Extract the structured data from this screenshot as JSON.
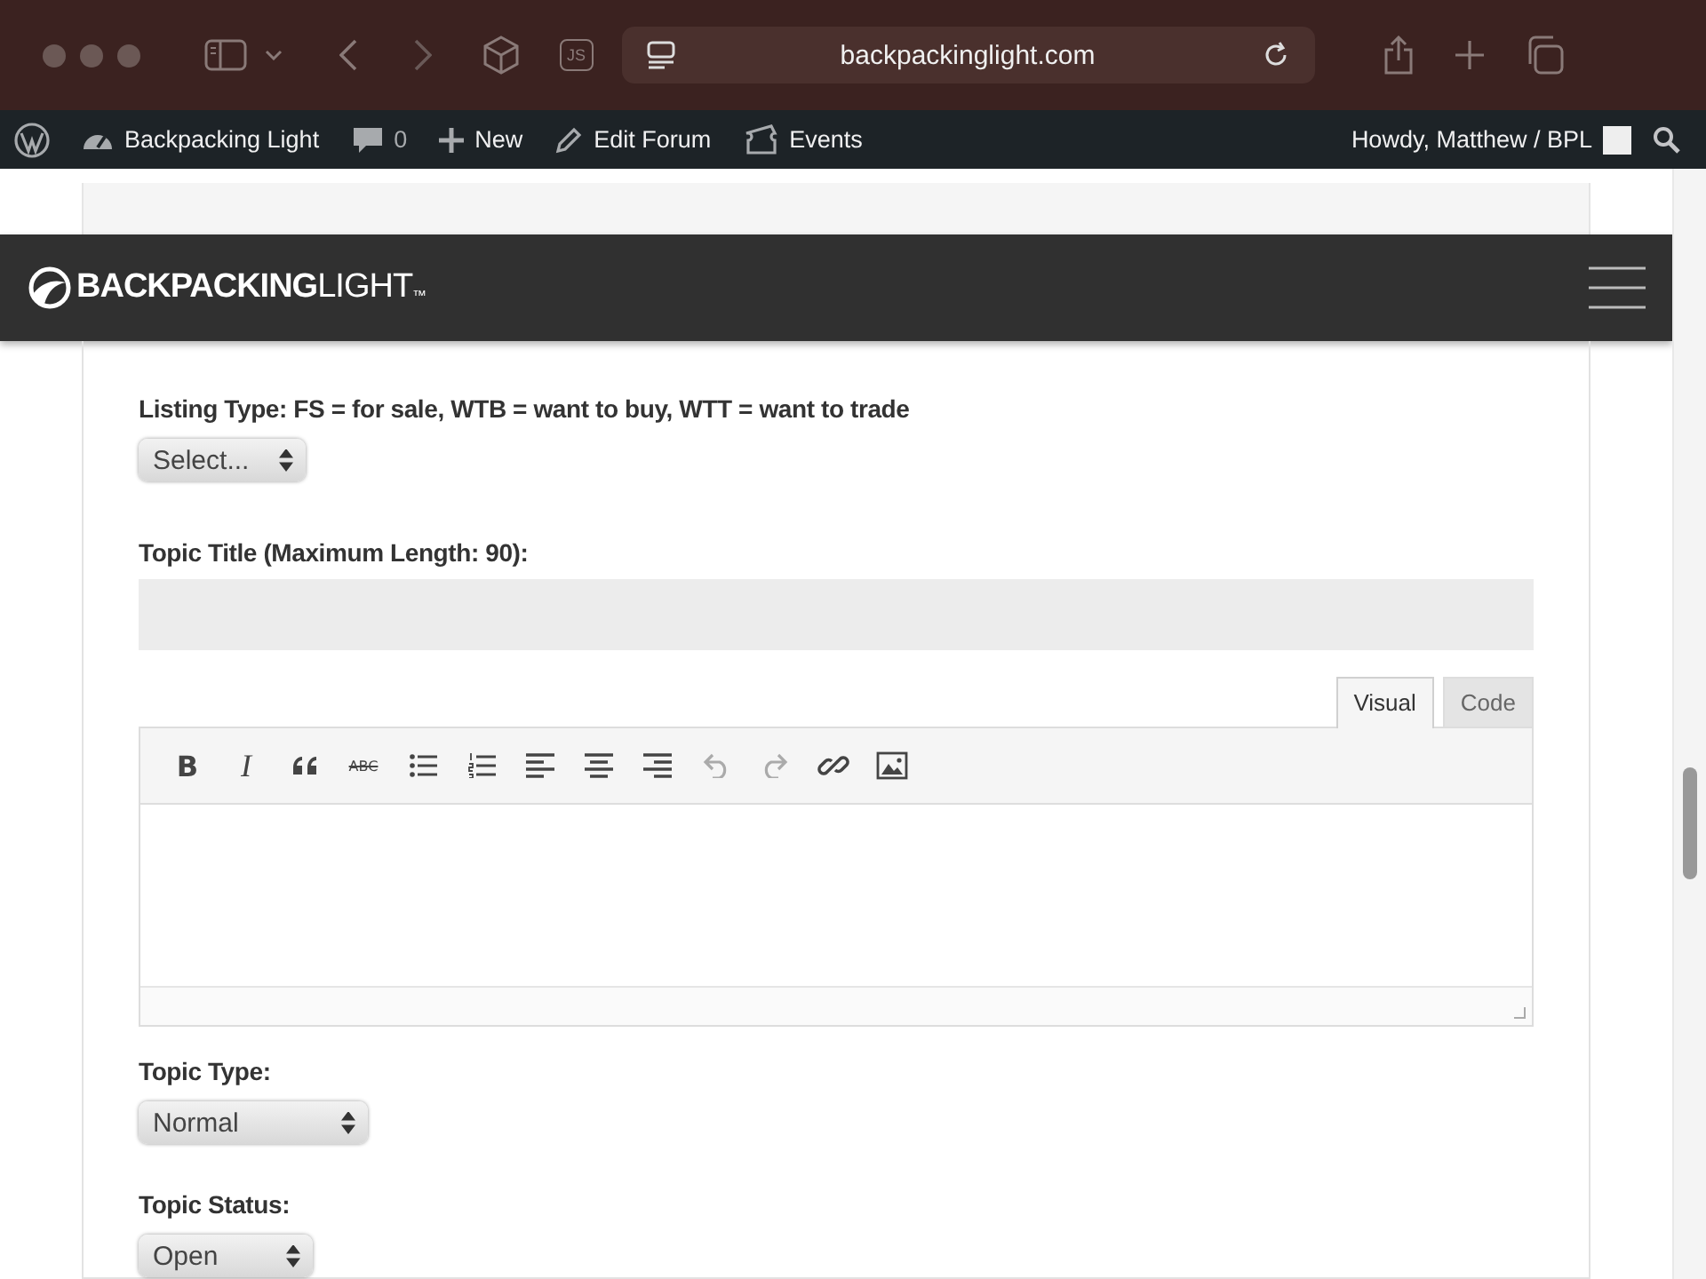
{
  "browser": {
    "url": "backpackinglight.com",
    "js_badge": "JS"
  },
  "admin_bar": {
    "site": "Backpacking Light",
    "comments": "0",
    "new": "New",
    "edit": "Edit Forum",
    "events": "Events",
    "user": "Howdy, Matthew / BPL"
  },
  "site_header": {
    "logo_bold": "BACKPACKING",
    "logo_light": "LIGHT",
    "logo_mark": "™"
  },
  "form": {
    "listing_type": {
      "label": "Listing Type: FS = for sale, WTB = want to buy, WTT = want to trade",
      "value": "Select..."
    },
    "topic_title": {
      "label": "Topic Title (Maximum Length: 90):"
    },
    "editor": {
      "tabs": [
        {
          "label": "Visual",
          "selected": true
        },
        {
          "label": "Code",
          "selected": false
        }
      ],
      "toolbar": [
        {
          "kind": "bold",
          "label": "B",
          "disabled": false
        },
        {
          "kind": "italic",
          "label": "I",
          "disabled": false
        },
        {
          "kind": "quote",
          "disabled": false
        },
        {
          "kind": "strike",
          "label": "ABC",
          "disabled": false
        },
        {
          "kind": "bullets",
          "disabled": false
        },
        {
          "kind": "numbers",
          "disabled": false
        },
        {
          "kind": "align-left",
          "disabled": false
        },
        {
          "kind": "align-center",
          "disabled": false
        },
        {
          "kind": "align-right",
          "disabled": false
        },
        {
          "kind": "undo",
          "disabled": true
        },
        {
          "kind": "redo",
          "disabled": true
        },
        {
          "kind": "link",
          "disabled": false
        },
        {
          "kind": "image",
          "disabled": false
        }
      ]
    },
    "topic_type": {
      "label": "Topic Type:",
      "value": "Normal"
    },
    "topic_status": {
      "label": "Topic Status:",
      "value": "Open"
    }
  }
}
